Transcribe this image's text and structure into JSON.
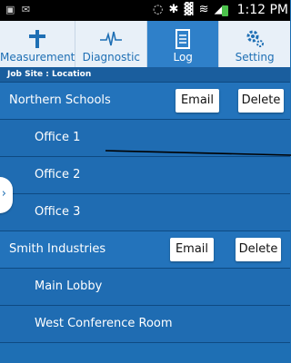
{
  "status_bar": {
    "notification_icons": "▣ ✉",
    "system_icons": "◌ ✱ ▓ ≋ ◢",
    "time": "1:12 PM"
  },
  "tabs": [
    {
      "label": "Measurement",
      "icon": "measurement-icon"
    },
    {
      "label": "Diagnostic",
      "icon": "pulse-icon"
    },
    {
      "label": "Log",
      "icon": "document-icon",
      "active": true
    },
    {
      "label": "Setting",
      "icon": "gear-icon"
    }
  ],
  "section_header": "Job Site : Location",
  "buttons": {
    "email": "Email",
    "delete": "Delete"
  },
  "companies": [
    {
      "name": "Northern Schools",
      "offices": [
        "Office 1",
        "Office 2",
        "Office 3"
      ]
    },
    {
      "name": "Smith Industries",
      "offices": [
        "Main Lobby",
        "West Conference Room"
      ]
    }
  ],
  "colors": {
    "primary": "#1e6fb4",
    "tab_active": "#2f80c9",
    "tab_bg": "#e8f0f8"
  }
}
